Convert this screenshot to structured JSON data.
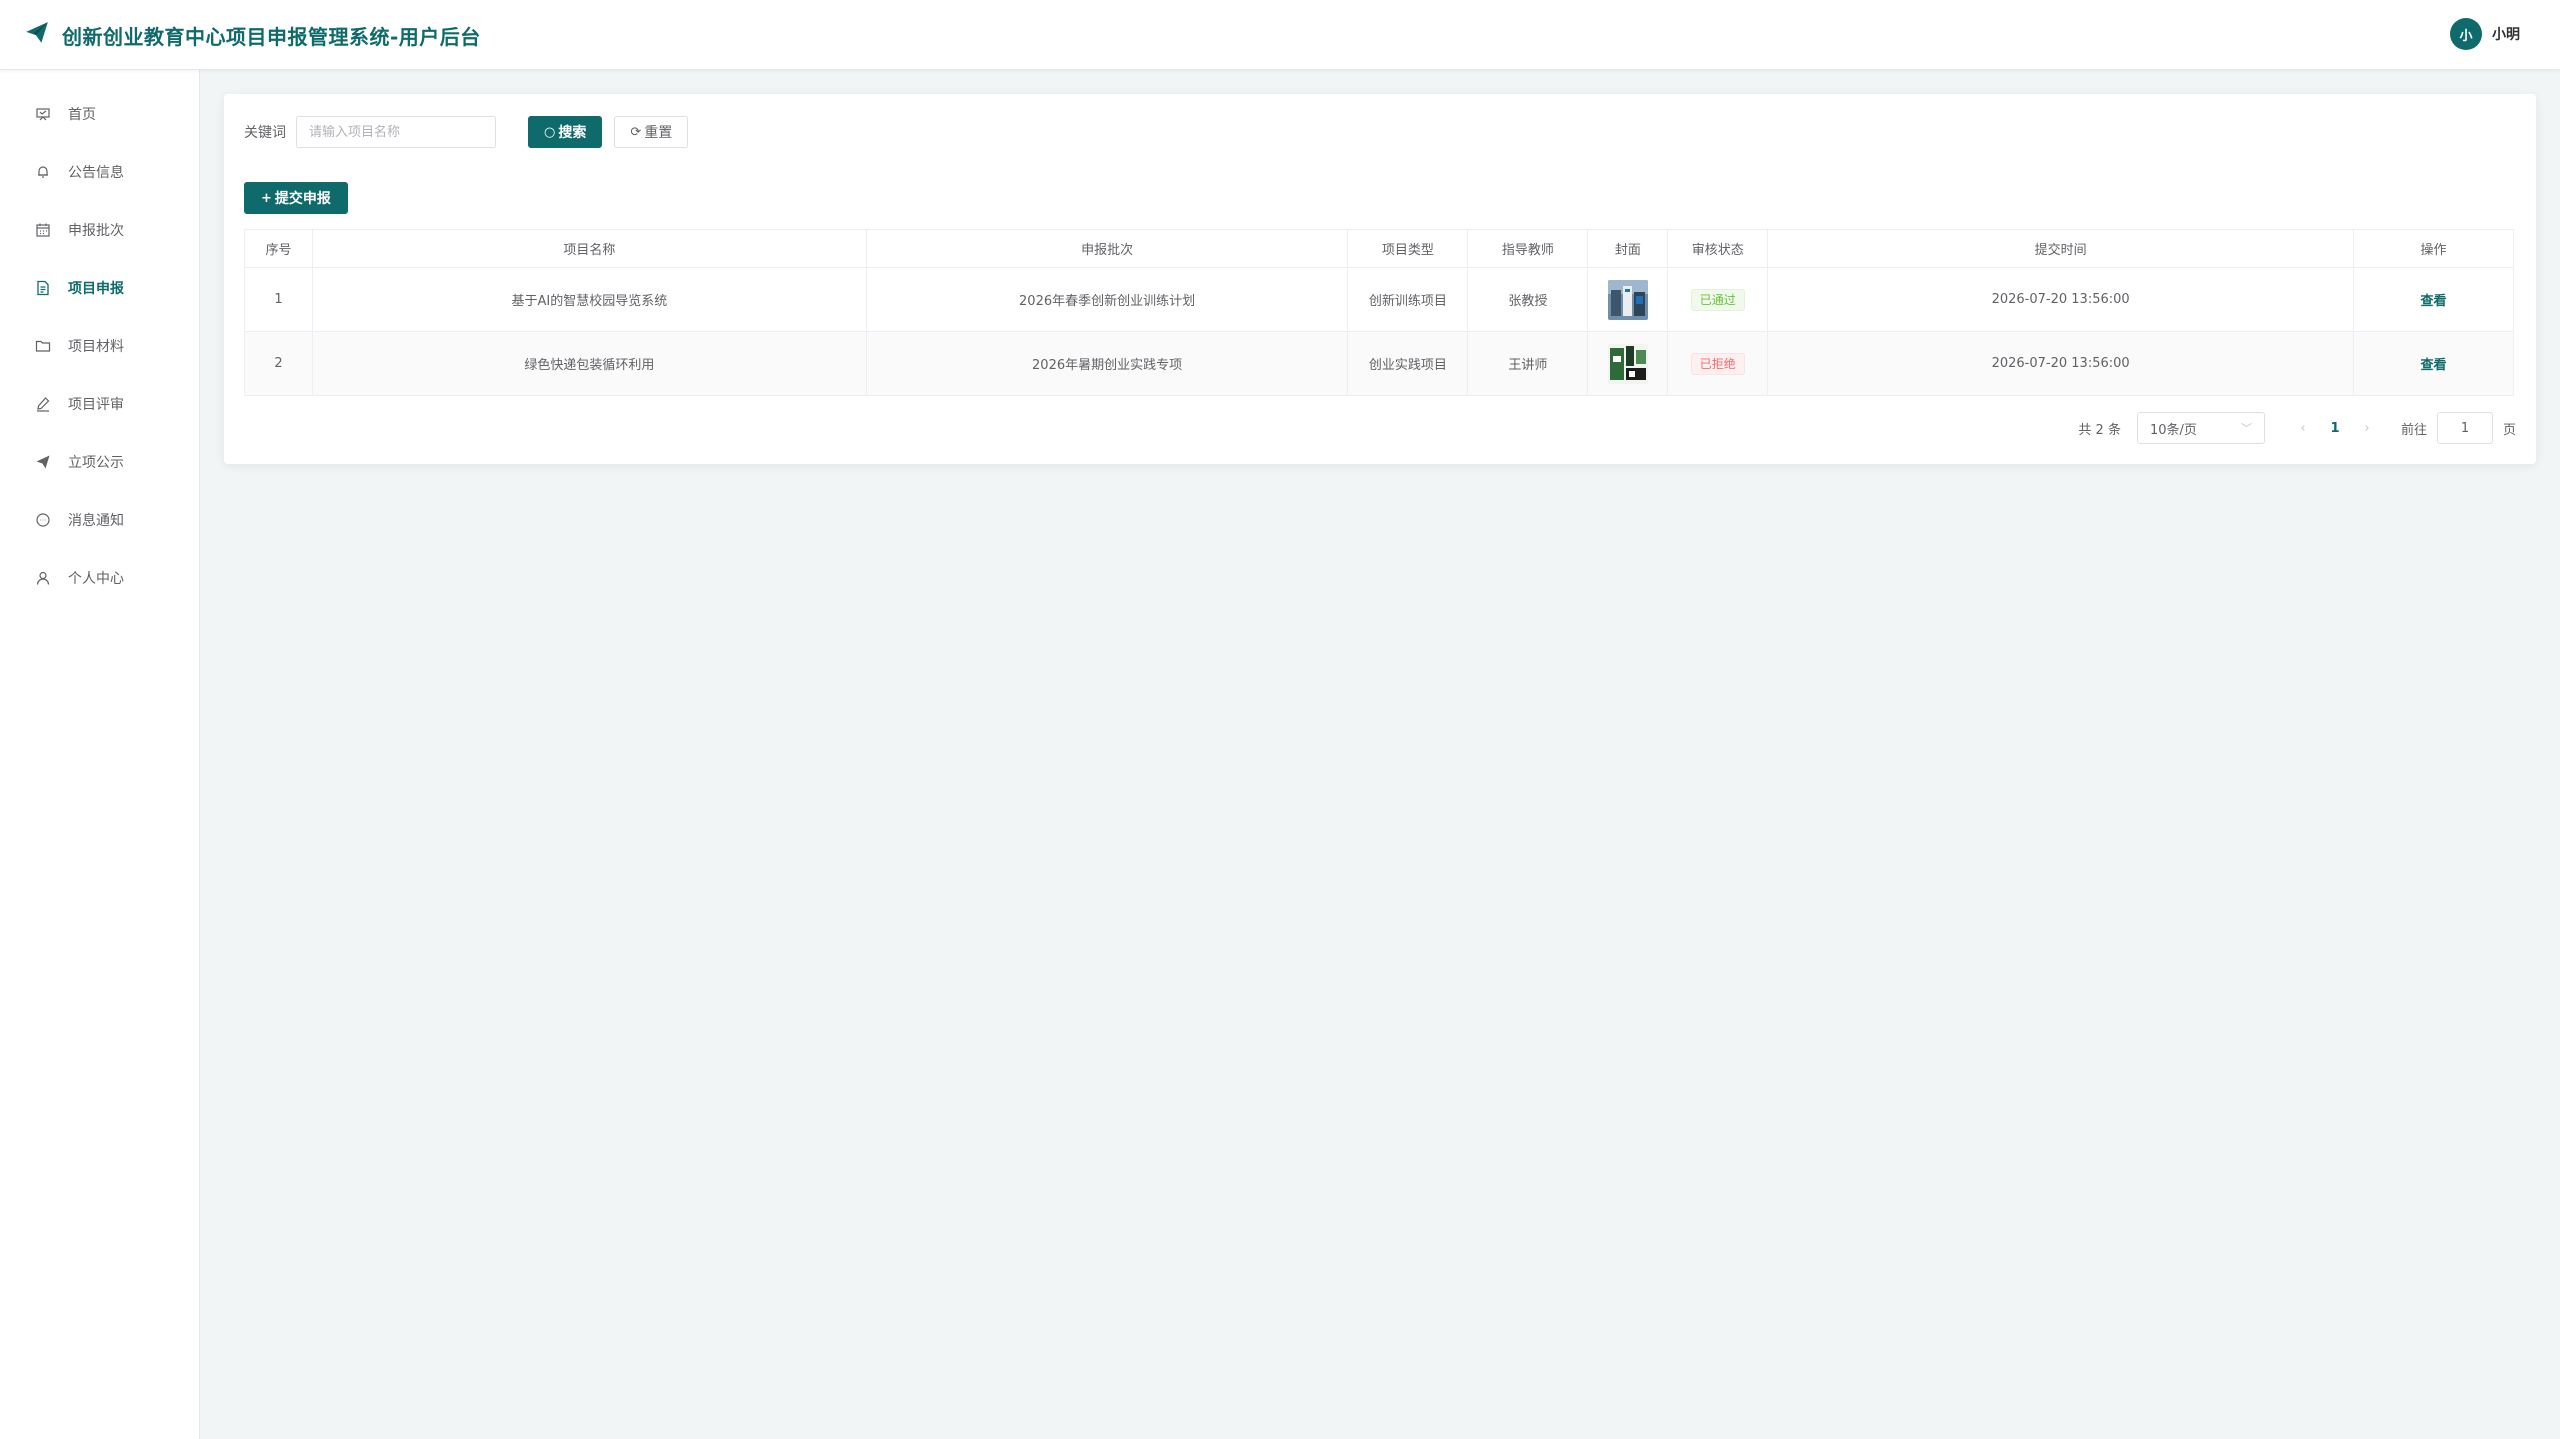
{
  "app": {
    "title": "创新创业教育中心项目申报管理系统-用户后台"
  },
  "user": {
    "avatar_text": "小",
    "name": "小明"
  },
  "sidebar": {
    "items": [
      {
        "label": "首页",
        "icon": "home-icon",
        "active": false
      },
      {
        "label": "公告信息",
        "icon": "bell-icon",
        "active": false
      },
      {
        "label": "申报批次",
        "icon": "calendar-icon",
        "active": false
      },
      {
        "label": "项目申报",
        "icon": "document-icon",
        "active": true
      },
      {
        "label": "项目材料",
        "icon": "folder-icon",
        "active": false
      },
      {
        "label": "项目评审",
        "icon": "edit-icon",
        "active": false
      },
      {
        "label": "立项公示",
        "icon": "send-icon",
        "active": false
      },
      {
        "label": "消息通知",
        "icon": "chat-icon",
        "active": false
      },
      {
        "label": "个人中心",
        "icon": "user-icon",
        "active": false
      }
    ]
  },
  "search": {
    "label": "关键词",
    "placeholder": "请输入项目名称",
    "value": "",
    "search_button": "搜索",
    "reset_button": "重置"
  },
  "toolbar": {
    "submit_label": "提交申报"
  },
  "table": {
    "columns": [
      "序号",
      "项目名称",
      "申报批次",
      "项目类型",
      "指导教师",
      "封面",
      "审核状态",
      "提交时间",
      "操作"
    ],
    "rows": [
      {
        "index": "1",
        "name": "基于AI的智慧校园导览系统",
        "batch": "2026年春季创新创业训练计划",
        "type": "创新训练项目",
        "teacher": "张教授",
        "status": "已通过",
        "status_type": "success",
        "time": "2026-07-20 13:56:00",
        "action": "查看"
      },
      {
        "index": "2",
        "name": "绿色快递包装循环利用",
        "batch": "2026年暑期创业实践专项",
        "type": "创业实践项目",
        "teacher": "王讲师",
        "status": "已拒绝",
        "status_type": "danger",
        "time": "2026-07-20 13:56:00",
        "action": "查看"
      }
    ]
  },
  "pagination": {
    "total_text": "共 2 条",
    "page_size": "10条/页",
    "current_page": "1",
    "goto_label": "前往",
    "goto_value": "1",
    "page_suffix": "页"
  },
  "colors": {
    "brand": "#0f6b6b",
    "success": "#67c23a",
    "danger": "#f56c6c"
  }
}
